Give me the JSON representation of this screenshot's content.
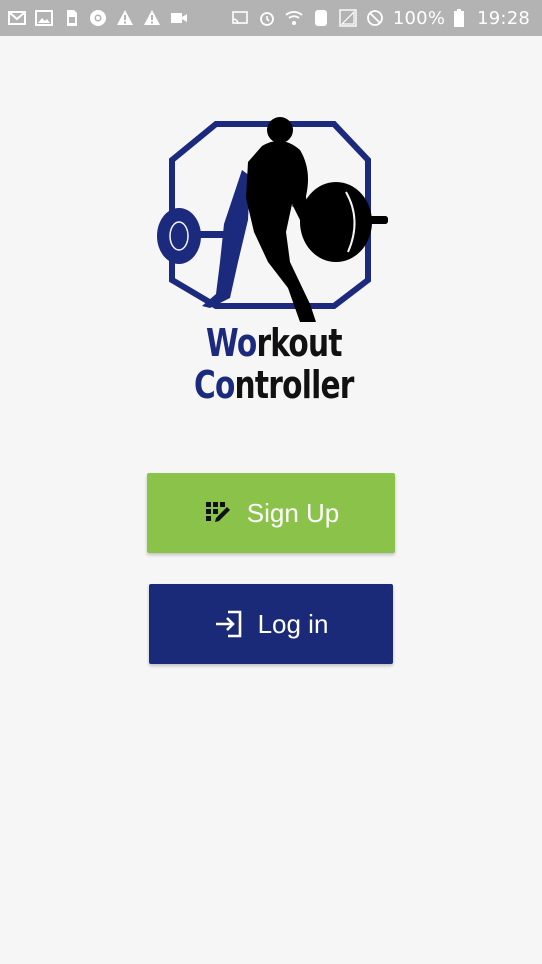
{
  "status_bar": {
    "battery_percent": "100%",
    "time": "19:28",
    "left_icons": [
      "gmail-icon",
      "image-icon",
      "sim-icon",
      "chrome-icon",
      "warning-icon",
      "warning-icon",
      "video-icon"
    ],
    "right_icons": [
      "cast-icon",
      "alarm-icon",
      "wifi-icon",
      "phone-icon",
      "signal-icon",
      "do-not-disturb-icon",
      "battery-icon"
    ]
  },
  "logo": {
    "line1_accent": "Wo",
    "line1_rest": "rkout",
    "line2_accent": "Co",
    "line2_rest": "ntroller",
    "accent_color": "#1c2a7e"
  },
  "actions": {
    "signup_label": "Sign Up",
    "signup_icon": "signup-grid-pencil-icon",
    "signup_color": "#8bc34a",
    "login_label": "Log in",
    "login_icon": "login-arrow-icon",
    "login_color": "#1a2a78"
  }
}
